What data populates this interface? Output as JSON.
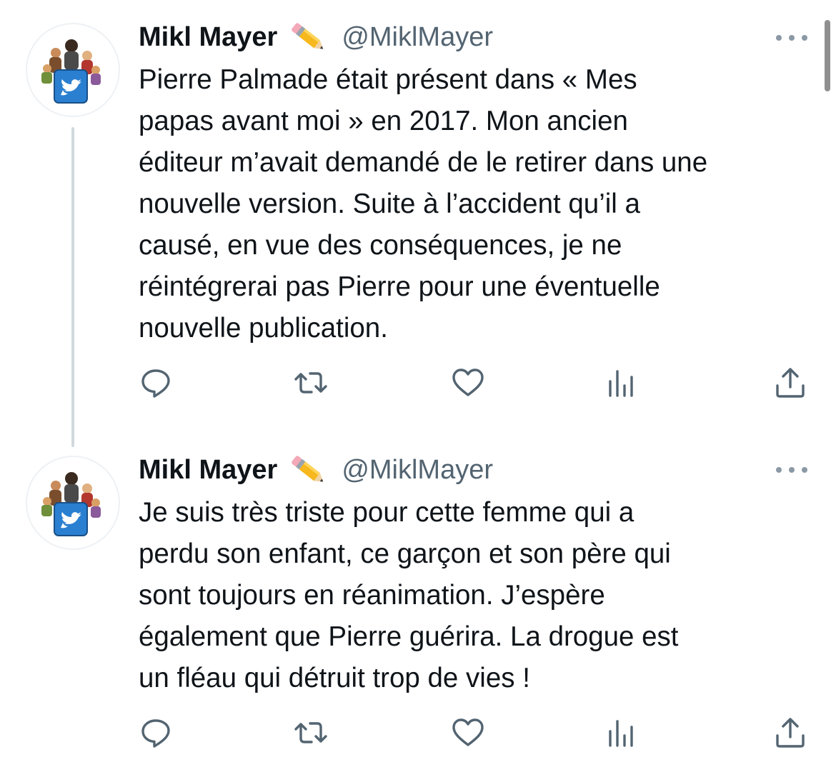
{
  "tweets": [
    {
      "display_name": "Mikl Mayer",
      "name_emoji": "pencil-emoji",
      "handle": "@MiklMayer",
      "text": "Pierre Palmade était présent dans « Mes\npapas avant moi » en 2017. Mon ancien\néditeur m’avait demandé de le retirer dans une\nnouvelle version. Suite à l’accident qu’il a\ncausé, en vue des conséquences, je ne\nréintégrerai pas Pierre pour une éventuelle\nnouvelle publication.",
      "actions": [
        "reply-icon",
        "retweet-icon",
        "like-icon",
        "views-icon",
        "share-icon"
      ]
    },
    {
      "display_name": "Mikl Mayer",
      "name_emoji": "pencil-emoji",
      "handle": "@MiklMayer",
      "text": "Je suis très triste pour cette femme qui a\nperdu son enfant, ce garçon et son père qui\nsont toujours en réanimation. J’espère\négalement que Pierre guérira. La drogue est\nun fléau qui détruit trop de vies !",
      "actions": [
        "reply-icon",
        "retweet-icon",
        "like-icon",
        "views-icon",
        "share-icon"
      ]
    }
  ],
  "colors": {
    "text": "#0f1419",
    "secondary": "#536471",
    "thread_line": "#cfd9de",
    "twitter_blue": "#1d9bf0"
  }
}
